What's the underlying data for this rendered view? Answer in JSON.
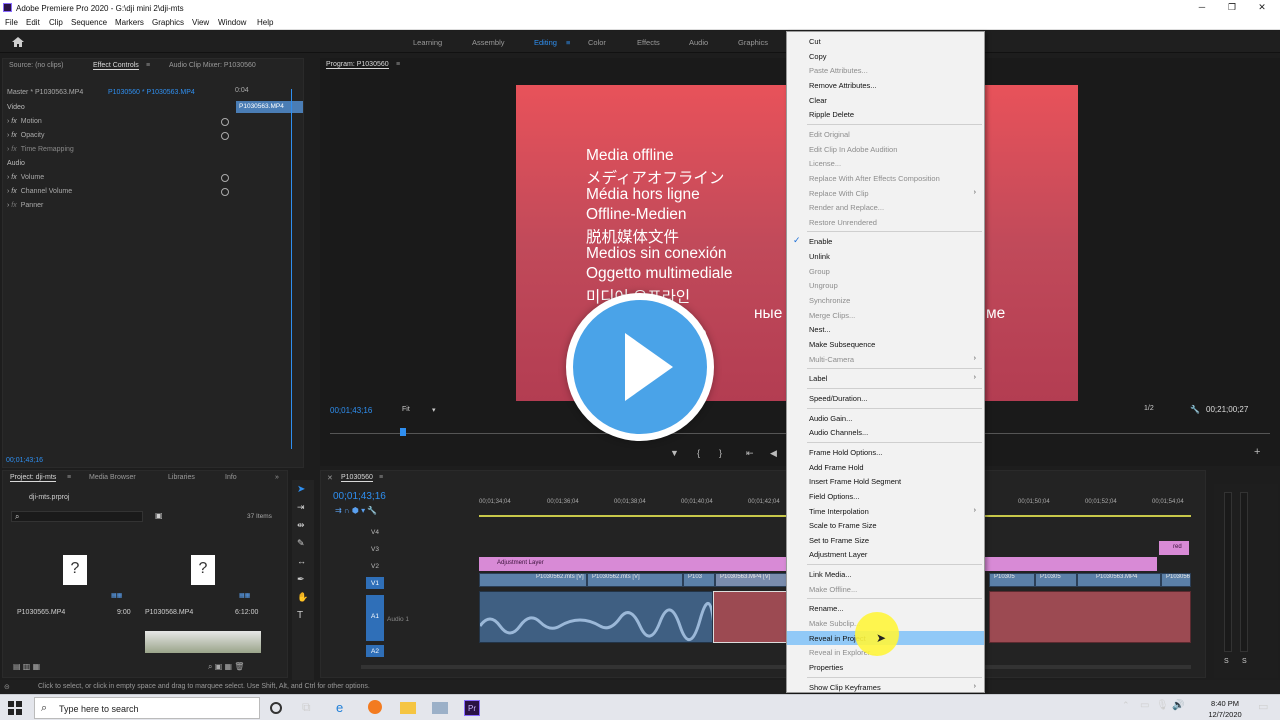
{
  "window": {
    "title": "Adobe Premiere Pro 2020 - G:\\dji mini 2\\dji-mts"
  },
  "menubar": [
    "File",
    "Edit",
    "Clip",
    "Sequence",
    "Markers",
    "Graphics",
    "View",
    "Window",
    "Help"
  ],
  "workspaces": {
    "items": [
      "Learning",
      "Assembly",
      "Editing",
      "Color",
      "Effects",
      "Audio",
      "Graphics"
    ],
    "active": "Editing"
  },
  "effect_controls": {
    "tabs": [
      "Source: (no clips)",
      "Effect Controls",
      "Audio Clip Mixer: P1030560"
    ],
    "master": "Master * P1030563.MP4",
    "clip": "P1030560 * P1030563.MP4",
    "time_start": "0:04",
    "clip_bar_label": "P1030563.MP4",
    "video_header": "Video",
    "video_props": [
      "Motion",
      "Opacity",
      "Time Remapping"
    ],
    "audio_header": "Audio",
    "audio_props": [
      "Volume",
      "Channel Volume",
      "Panner"
    ],
    "timecode": "00;01;43;16"
  },
  "program": {
    "tab": "Program: P1030560",
    "timecode_current": "00;01;43;16",
    "fit": "Fit",
    "resolution": "1/2",
    "timecode_duration": "00;21;00;27",
    "offline_lines": [
      "Media offline",
      "メディアオフライン",
      "Média hors ligne",
      "Offline-Medien",
      "脱机媒体文件",
      "Medios sin conexión",
      "Oggetto multimediale",
      "미디어 오프라인",
      "ные в а",
      "ме",
      "e"
    ]
  },
  "project": {
    "tabs": [
      "Project: dji-mts",
      "Media Browser",
      "Libraries",
      "Info"
    ],
    "file": "dji-mts.prproj",
    "items_count": "37 Items",
    "items": [
      {
        "name": "P1030565.MP4",
        "duration": "9:00"
      },
      {
        "name": "P1030568.MP4",
        "duration": "6:12:00"
      }
    ]
  },
  "timeline": {
    "tab": "P1030560",
    "timecode": "00;01;43;16",
    "ruler": [
      "00;01;34;04",
      "00;01;36;04",
      "00;01;38;04",
      "00;01;40;04",
      "00;01;42;04",
      "00;01;50;04",
      "00;01;52;04",
      "00;01;54;04"
    ],
    "tracks": [
      "V4",
      "V3",
      "V2",
      "V1",
      "A1",
      "A2"
    ],
    "audio_track_name": "Audio 1",
    "adjustment_layer": "Adjustment Layer",
    "clips": [
      "P1030562.mts [V]",
      "P1030562.mts [V]",
      "P103",
      "P1030563.MP4 [V]",
      "P10305",
      "P10305",
      "P1030563.MP4",
      "P1030564"
    ],
    "red_label": "red"
  },
  "context_menu": {
    "items": [
      {
        "label": "Cut",
        "disabled": false
      },
      {
        "label": "Copy",
        "disabled": false
      },
      {
        "label": "Paste Attributes...",
        "disabled": true
      },
      {
        "label": "Remove Attributes...",
        "disabled": false
      },
      {
        "label": "Clear",
        "disabled": false
      },
      {
        "label": "Ripple Delete",
        "disabled": false
      },
      {
        "sep": true
      },
      {
        "label": "Edit Original",
        "disabled": true
      },
      {
        "label": "Edit Clip In Adobe Audition",
        "disabled": true
      },
      {
        "label": "License...",
        "disabled": true
      },
      {
        "label": "Replace With After Effects Composition",
        "disabled": true
      },
      {
        "label": "Replace With Clip",
        "disabled": true,
        "submenu": true
      },
      {
        "label": "Render and Replace...",
        "disabled": true
      },
      {
        "label": "Restore Unrendered",
        "disabled": true
      },
      {
        "sep": true
      },
      {
        "label": "Enable",
        "disabled": false,
        "checked": true
      },
      {
        "label": "Unlink",
        "disabled": false
      },
      {
        "label": "Group",
        "disabled": true
      },
      {
        "label": "Ungroup",
        "disabled": true
      },
      {
        "label": "Synchronize",
        "disabled": true
      },
      {
        "label": "Merge Clips...",
        "disabled": true
      },
      {
        "label": "Nest...",
        "disabled": false
      },
      {
        "label": "Make Subsequence",
        "disabled": false
      },
      {
        "label": "Multi-Camera",
        "disabled": true,
        "submenu": true
      },
      {
        "sep": true
      },
      {
        "label": "Label",
        "disabled": false,
        "submenu": true
      },
      {
        "sep": true
      },
      {
        "label": "Speed/Duration...",
        "disabled": false
      },
      {
        "sep": true
      },
      {
        "label": "Audio Gain...",
        "disabled": false
      },
      {
        "label": "Audio Channels...",
        "disabled": false
      },
      {
        "sep": true
      },
      {
        "label": "Frame Hold Options...",
        "disabled": false
      },
      {
        "label": "Add Frame Hold",
        "disabled": false
      },
      {
        "label": "Insert Frame Hold Segment",
        "disabled": false
      },
      {
        "label": "Field Options...",
        "disabled": false
      },
      {
        "label": "Time Interpolation",
        "disabled": false,
        "submenu": true
      },
      {
        "label": "Scale to Frame Size",
        "disabled": false
      },
      {
        "label": "Set to Frame Size",
        "disabled": false
      },
      {
        "label": "Adjustment Layer",
        "disabled": false
      },
      {
        "sep": true
      },
      {
        "label": "Link Media...",
        "disabled": false
      },
      {
        "label": "Make Offline...",
        "disabled": true
      },
      {
        "sep": true
      },
      {
        "label": "Rename...",
        "disabled": false
      },
      {
        "label": "Make Subclip...",
        "disabled": true
      },
      {
        "label": "Reveal in Project",
        "disabled": false,
        "highlighted": true
      },
      {
        "label": "Reveal in Explorer...",
        "disabled": true
      },
      {
        "label": "Properties",
        "disabled": false
      },
      {
        "sep": true
      },
      {
        "label": "Show Clip Keyframes",
        "disabled": false,
        "submenu": true
      }
    ]
  },
  "statusbar": {
    "text": "Click to select, or click in empty space and drag to marquee select. Use Shift, Alt, and Ctrl for other options."
  },
  "taskbar": {
    "search_placeholder": "Type here to search",
    "time": "8:40 PM",
    "date": "12/7/2020"
  },
  "colors": {
    "accent": "#2f8ff0",
    "adjustment_layer": "#d88ad6",
    "video_clip": "#5b80a8",
    "menu_highlight": "#91c9f7"
  }
}
